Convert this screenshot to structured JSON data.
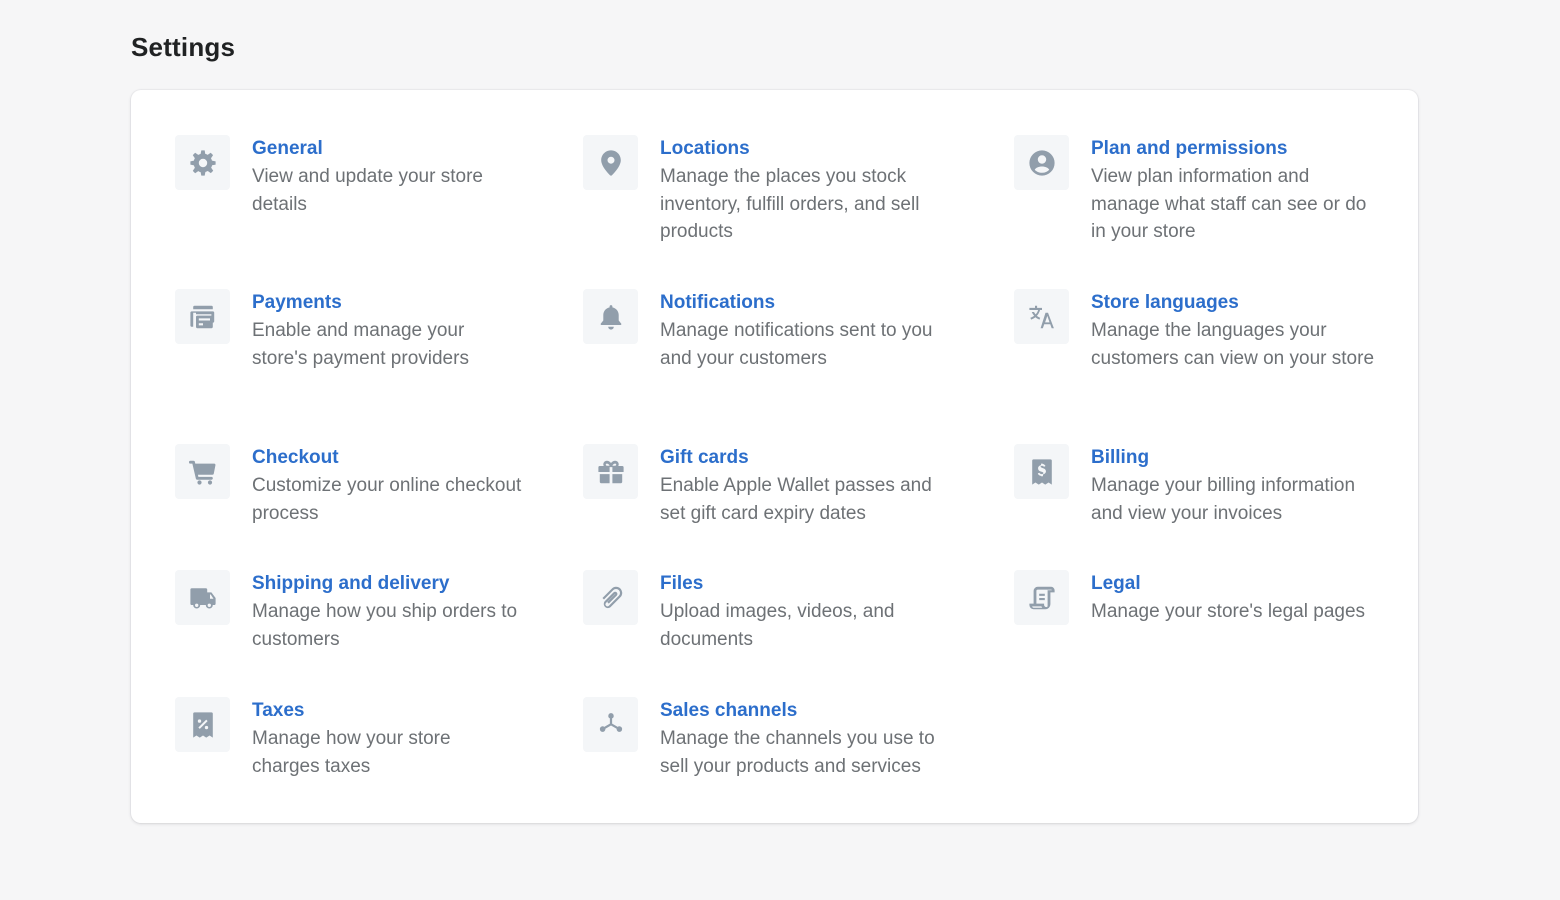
{
  "page": {
    "title": "Settings"
  },
  "colors": {
    "background": "#f6f6f7",
    "card": "#ffffff",
    "link": "#2c6ecb",
    "description": "#6d7175",
    "icon": "#919eab",
    "icon_bg": "#f4f6f8"
  },
  "items": [
    {
      "title": "General",
      "description": "View and update your store details",
      "icon": "gear-icon"
    },
    {
      "title": "Locations",
      "description": "Manage the places you stock inventory, fulfill orders, and sell products",
      "icon": "location-pin-icon"
    },
    {
      "title": "Plan and permissions",
      "description": "View plan information and manage what staff can see or do in your store",
      "icon": "user-circle-icon"
    },
    {
      "title": "Payments",
      "description": "Enable and manage your store's payment providers",
      "icon": "payment-cards-icon"
    },
    {
      "title": "Notifications",
      "description": "Manage notifications sent to you and your customers",
      "icon": "bell-icon"
    },
    {
      "title": "Store languages",
      "description": "Manage the languages your customers can view on your store",
      "icon": "translate-icon"
    },
    {
      "title": "Checkout",
      "description": "Customize your online checkout process",
      "icon": "cart-icon"
    },
    {
      "title": "Gift cards",
      "description": "Enable Apple Wallet passes and set gift card expiry dates",
      "icon": "gift-icon"
    },
    {
      "title": "Billing",
      "description": "Manage your billing information and view your invoices",
      "icon": "dollar-document-icon"
    },
    {
      "title": "Shipping and delivery",
      "description": "Manage how you ship orders to customers",
      "icon": "truck-icon"
    },
    {
      "title": "Files",
      "description": "Upload images, videos, and documents",
      "icon": "paperclip-icon"
    },
    {
      "title": "Legal",
      "description": "Manage your store's legal pages",
      "icon": "legal-document-icon"
    },
    {
      "title": "Taxes",
      "description": "Manage how your store charges taxes",
      "icon": "tax-receipt-icon"
    },
    {
      "title": "Sales channels",
      "description": "Manage the channels you use to sell your products and services",
      "icon": "sales-channels-icon"
    }
  ]
}
